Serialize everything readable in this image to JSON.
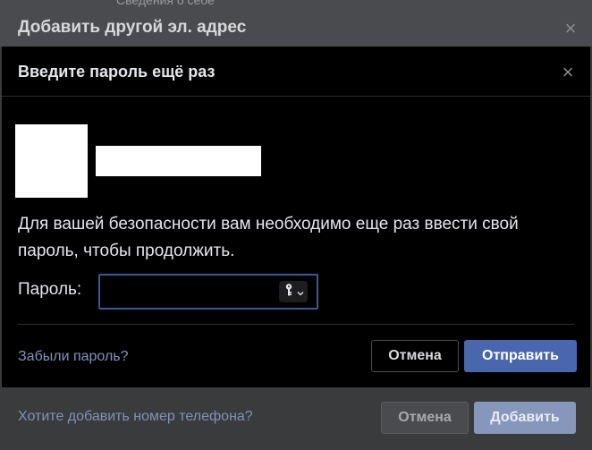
{
  "background": {
    "cutoff_text": "Сведения о себе"
  },
  "outer_dialog": {
    "title": "Добавить другой эл. адрес",
    "close_icon": "close-icon",
    "phone_link": "Хотите добавить номер телефона?",
    "cancel_label": "Отмена",
    "add_label": "Добавить"
  },
  "inner_dialog": {
    "title": "Введите пароль ещё раз",
    "close_icon": "close-icon",
    "message": "Для вашей безопасности вам необходимо еще раз ввести свой пароль, чтобы продолжить.",
    "password_label": "Пароль:",
    "password_value": "",
    "key_icon": "key-icon",
    "forgot_link": "Забыли пароль?",
    "cancel_label": "Отмена",
    "submit_label": "Отправить"
  },
  "colors": {
    "primary_button": "#4a67ad",
    "disabled_primary": "#8797bb",
    "link": "#7f93b8",
    "input_focus_border": "#3b5998"
  }
}
